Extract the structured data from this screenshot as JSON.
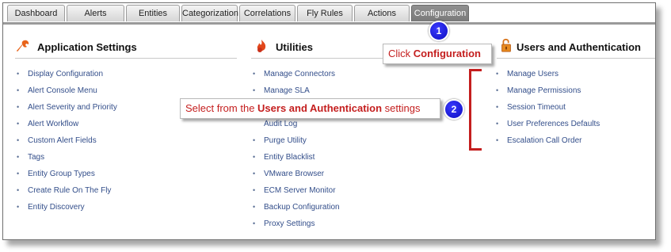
{
  "tabs": [
    {
      "label": "Dashboard",
      "active": false
    },
    {
      "label": "Alerts",
      "active": false
    },
    {
      "label": "Entities",
      "active": false
    },
    {
      "label": "Categorization",
      "active": false
    },
    {
      "label": "Correlations",
      "active": false
    },
    {
      "label": "Fly Rules",
      "active": false
    },
    {
      "label": "Actions",
      "active": false
    },
    {
      "label": "Configuration",
      "active": true
    }
  ],
  "sections": {
    "app": {
      "title": "Application Settings",
      "icon": "wrench-icon",
      "items": [
        "Display Configuration",
        "Alert Console Menu",
        "Alert Severity and Priority",
        "Alert Workflow",
        "Custom Alert Fields",
        "Tags",
        "Entity Group Types",
        "Create Rule On The Fly",
        "Entity Discovery"
      ]
    },
    "util": {
      "title": "Utilities",
      "icon": "utilities-icon",
      "items": [
        "Manage Connectors",
        "Manage SLA",
        "",
        "Audit Log",
        "Purge Utility",
        "Entity Blacklist",
        "VMware Browser",
        "ECM Server Monitor",
        "Backup Configuration",
        "Proxy Settings"
      ]
    },
    "users": {
      "title": "Users and Authentication",
      "icon": "lock-icon",
      "items": [
        "Manage Users",
        "Manage Permissions",
        "Session Timeout",
        "User Preferences Defaults",
        "Escalation Call Order"
      ]
    }
  },
  "callouts": {
    "one": {
      "prefix": "Click ",
      "bold": "Configuration",
      "suffix": "",
      "badge": "1"
    },
    "two": {
      "prefix": "Select from the ",
      "bold": "Users and Authentication",
      "suffix": " settings",
      "badge": "2"
    }
  },
  "colors": {
    "accent_red": "#c41e1e",
    "link_blue": "#334e8a",
    "badge_blue": "#1515d8",
    "active_tab": "#868686"
  }
}
